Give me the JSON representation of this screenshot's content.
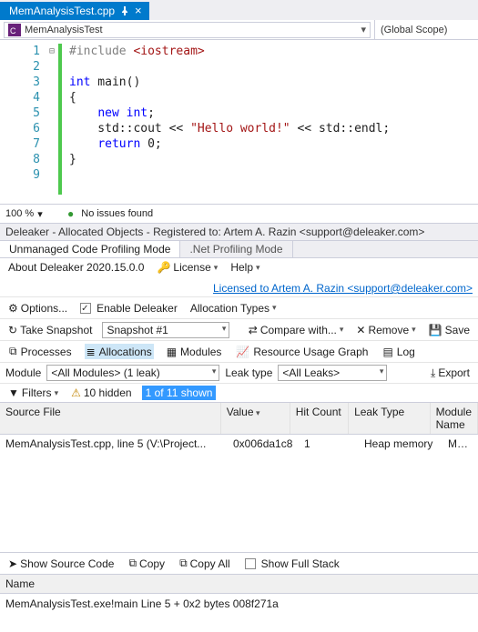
{
  "tab": {
    "title": "MemAnalysisTest.cpp"
  },
  "nav": {
    "class": "MemAnalysisTest",
    "scope": "(Global Scope)"
  },
  "code": {
    "lines": [
      "1",
      "2",
      "3",
      "4",
      "5",
      "6",
      "7",
      "8",
      "9"
    ],
    "l1_pre": "#include ",
    "l1_inc": "<iostream>",
    "l3_a": "int",
    "l3_b": " main()",
    "l4": "{",
    "l5_a": "    ",
    "l5_kw": "new",
    "l5_b": " ",
    "l5_ty": "int",
    "l5_c": ";",
    "l6_a": "    std::cout << ",
    "l6_str": "\"Hello world!\"",
    "l6_b": " << std::endl;",
    "l7_a": "    ",
    "l7_kw": "return",
    "l7_b": " 0;",
    "l8": "}"
  },
  "status": {
    "zoom": "100 %",
    "issues": "No issues found"
  },
  "panel": {
    "title": "Deleaker - Allocated Objects - Registered to: Artem A. Razin <support@deleaker.com>",
    "tab1": "Unmanaged Code Profiling Mode",
    "tab2": ".Net Profiling Mode",
    "about": "About Deleaker 2020.15.0.0",
    "license": "License",
    "help": "Help",
    "licensed": "Licensed to Artem A. Razin <support@deleaker.com>",
    "options": "Options...",
    "enable": "Enable Deleaker",
    "alloc_types": "Allocation Types",
    "take": "Take Snapshot",
    "snapshot": "Snapshot #1",
    "compare": "Compare with...",
    "remove": "Remove",
    "save": "Save",
    "st_proc": "Processes",
    "st_alloc": "Allocations",
    "st_mod": "Modules",
    "st_res": "Resource Usage Graph",
    "st_log": "Log",
    "module_lbl": "Module",
    "module_val": "<All Modules> (1 leak)",
    "leak_lbl": "Leak type",
    "leak_val": "<All Leaks>",
    "export": "Export",
    "filters": "Filters",
    "hidden": "10 hidden",
    "shown": "1 of 11 shown",
    "gh_src": "Source File",
    "gh_val": "Value",
    "gh_hit": "Hit Count",
    "gh_leak": "Leak Type",
    "gh_mod": "Module Name",
    "row_src": "MemAnalysisTest.cpp, line 5 (V:\\Project...",
    "row_val": "0x006da1c8",
    "row_hit": "1",
    "row_leak": "Heap memory",
    "row_mod": "MemAnalysisTest",
    "show_src": "Show Source Code",
    "copy": "Copy",
    "copyall": "Copy All",
    "fullstack": "Show Full Stack",
    "name_hdr": "Name",
    "stack_line": "MemAnalysisTest.exe!main Line 5 + 0x2 bytes 008f271a"
  }
}
